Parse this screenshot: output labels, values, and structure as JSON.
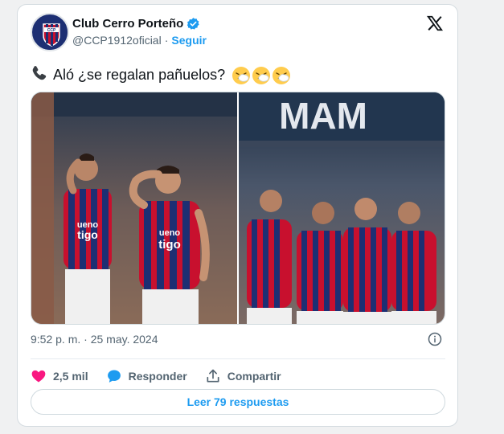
{
  "tweet": {
    "display_name": "Club Cerro Porteño",
    "handle": "@CCP1912oficial",
    "separator": "·",
    "follow_label": "Seguir",
    "text": "Aló ¿se regalan pañuelos?",
    "timestamp": "9:52 p. m. · 25 may. 2024",
    "media": [
      {
        "banner_text": "",
        "jersey_text_1": "ueno",
        "jersey_text_2": "tigo"
      },
      {
        "banner_text": "MAM"
      }
    ]
  },
  "actions": {
    "likes": "2,5 mil",
    "reply_label": "Responder",
    "share_label": "Compartir"
  },
  "read_replies": "Leer 79 respuestas",
  "colors": {
    "accent": "#1d9bf0",
    "like": "#f91880",
    "club_blue": "#1d2f73",
    "club_red": "#c8102e"
  },
  "icons": [
    "phone-icon",
    "sneezing-face-emoji",
    "verified-badge-icon",
    "x-logo-icon",
    "info-icon",
    "heart-icon",
    "reply-bubble-icon",
    "share-icon"
  ]
}
